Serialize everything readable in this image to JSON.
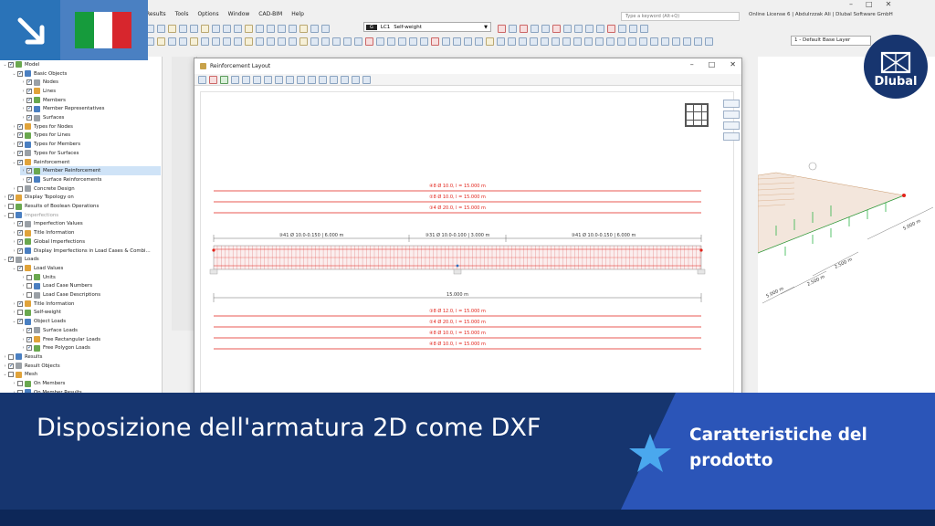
{
  "app": {
    "menu": [
      "Results",
      "Tools",
      "Options",
      "Window",
      "CAD-BIM",
      "Help"
    ],
    "search_placeholder": "Type a keyword (Alt+Q)",
    "license_text": "Online License 6 | Abdulrzzak Ali | Dlubal Software GmbH",
    "load_case_tag": "G",
    "load_case_id": "LC1",
    "load_case_name": "Self-weight",
    "base_layer": "1 - Default Base Layer"
  },
  "navigator": {
    "items": [
      {
        "label": "Model",
        "level": 0,
        "checked": true,
        "expanded": true
      },
      {
        "label": "Basic Objects",
        "level": 1,
        "checked": true,
        "expanded": true
      },
      {
        "label": "Nodes",
        "level": 2,
        "checked": true,
        "expanded": false
      },
      {
        "label": "Lines",
        "level": 2,
        "checked": true,
        "expanded": false
      },
      {
        "label": "Members",
        "level": 2,
        "checked": true,
        "expanded": false
      },
      {
        "label": "Member Representatives",
        "level": 2,
        "checked": true,
        "expanded": false
      },
      {
        "label": "Surfaces",
        "level": 2,
        "checked": true,
        "expanded": false
      },
      {
        "label": "Types for Nodes",
        "level": 1,
        "checked": true,
        "expanded": false
      },
      {
        "label": "Types for Lines",
        "level": 1,
        "checked": true,
        "expanded": false
      },
      {
        "label": "Types for Members",
        "level": 1,
        "checked": true,
        "expanded": false
      },
      {
        "label": "Types for Surfaces",
        "level": 1,
        "checked": true,
        "expanded": false
      },
      {
        "label": "Reinforcement",
        "level": 1,
        "checked": true,
        "expanded": true
      },
      {
        "label": "Member Reinforcement",
        "level": 2,
        "checked": true,
        "expanded": false,
        "selected": true
      },
      {
        "label": "Surface Reinforcements",
        "level": 2,
        "checked": true,
        "expanded": false
      },
      {
        "label": "Concrete Design",
        "level": 1,
        "checked": false,
        "expanded": false
      },
      {
        "label": "Display Topology on",
        "level": 0,
        "checked": true,
        "expanded": false
      },
      {
        "label": "Results of Boolean Operations",
        "level": 0,
        "checked": false,
        "expanded": false
      },
      {
        "label": "Imperfections",
        "level": 0,
        "checked": false,
        "expanded": true,
        "muted": true
      },
      {
        "label": "Imperfection Values",
        "level": 1,
        "checked": true,
        "expanded": false
      },
      {
        "label": "Title Information",
        "level": 1,
        "checked": true,
        "expanded": false
      },
      {
        "label": "Global Imperfections",
        "level": 1,
        "checked": true,
        "expanded": false
      },
      {
        "label": "Display Imperfections in Load Cases & Combi...",
        "level": 1,
        "checked": true,
        "expanded": false
      },
      {
        "label": "Loads",
        "level": 0,
        "checked": true,
        "expanded": true
      },
      {
        "label": "Load Values",
        "level": 1,
        "checked": true,
        "expanded": true
      },
      {
        "label": "Units",
        "level": 2,
        "checked": false,
        "expanded": false
      },
      {
        "label": "Load Case Numbers",
        "level": 2,
        "checked": false,
        "expanded": false
      },
      {
        "label": "Load Case Descriptions",
        "level": 2,
        "checked": false,
        "expanded": false
      },
      {
        "label": "Title Information",
        "level": 1,
        "checked": true,
        "expanded": false
      },
      {
        "label": "Self-weight",
        "level": 1,
        "checked": false,
        "expanded": false
      },
      {
        "label": "Object Loads",
        "level": 1,
        "checked": true,
        "expanded": true
      },
      {
        "label": "Surface Loads",
        "level": 2,
        "checked": true,
        "expanded": false
      },
      {
        "label": "Free Rectangular Loads",
        "level": 2,
        "checked": true,
        "expanded": false
      },
      {
        "label": "Free Polygon Loads",
        "level": 2,
        "checked": true,
        "expanded": false
      },
      {
        "label": "Results",
        "level": 0,
        "checked": false,
        "expanded": false
      },
      {
        "label": "Result Objects",
        "level": 0,
        "checked": true,
        "expanded": false
      },
      {
        "label": "Mesh",
        "level": 0,
        "checked": false,
        "expanded": true
      },
      {
        "label": "On Members",
        "level": 1,
        "checked": false,
        "expanded": false
      },
      {
        "label": "On Member Results",
        "level": 1,
        "checked": false,
        "expanded": false
      }
    ]
  },
  "dialog": {
    "title": "Reinforcement Layout",
    "top_bars": [
      "④8 Ø 10.0, l = 15.000 m",
      "②8 Ø 10.0, l = 15.000 m",
      "③4 Ø 20.0, l = 15.000 m"
    ],
    "stirrup_segments": [
      "③41 Ø 10.0-0.150 | 6.000 m",
      "③31 Ø 10.0-0.100 | 3.000 m",
      "③41 Ø 10.0-0.150 | 6.000 m"
    ],
    "span_label": "15.000 m",
    "bottom_bars": [
      "③8 Ø 12.0, l = 15.000 m",
      "②4 Ø 20.0, l = 15.000 m",
      "④8 Ø 10.0, l = 15.000 m",
      "④8 Ø 10.0, l = 15.000 m"
    ]
  },
  "viewport": {
    "dim_labels": [
      "5.000 m",
      "2.500 m",
      "2.500 m",
      "5.000 m"
    ]
  },
  "banner": {
    "title": "Disposizione dell'armatura 2D come DXF",
    "subtitle": "Caratteristiche del prodotto"
  },
  "logo": {
    "text": "Dlubal"
  },
  "colors": {
    "banner_dark": "#16356f",
    "banner_accent": "#2b55b8",
    "arrow_tile": "#2a73b8",
    "rebar_red": "#e2231a",
    "star": "#4aa8ee"
  }
}
